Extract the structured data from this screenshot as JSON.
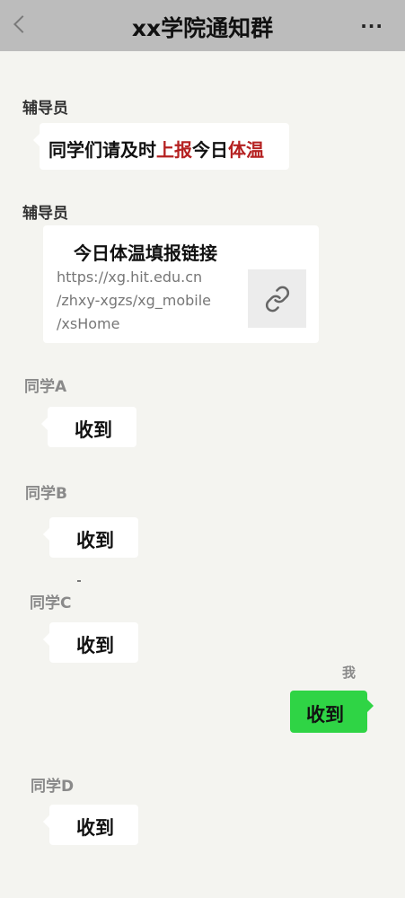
{
  "header": {
    "back_icon": "chevron-left-icon",
    "title": "xx学院通知群",
    "more_icon": "more-icon",
    "more_text": "···"
  },
  "messages": {
    "m1": {
      "sender": "辅导员",
      "text_parts": [
        "同学们请及时",
        "上报",
        "今日",
        "体温"
      ],
      "colors": {
        "normal": "#111111",
        "highlight": "#b52121"
      }
    },
    "m2": {
      "sender": "辅导员",
      "link_title": "今日体温填报链接",
      "link_url": "https://xg.hit.edu.cn/zhxy-xgzs/xg_mobile/xsHome",
      "link_url_lines": [
        "https://xg.hit.edu.cn",
        "/zhxy-xgzs/xg_mobile",
        "/xsHome"
      ],
      "thumb_icon": "link-icon"
    },
    "m3": {
      "sender": "同学A",
      "text": "收到"
    },
    "m4": {
      "sender": "同学B",
      "text": "收到"
    },
    "m5": {
      "sender": "同学C",
      "text": "收到"
    },
    "m6": {
      "sender": "我",
      "text": "收到",
      "bubble_color": "#2fd445"
    },
    "m7": {
      "sender": "同学D",
      "text": "收到"
    }
  }
}
